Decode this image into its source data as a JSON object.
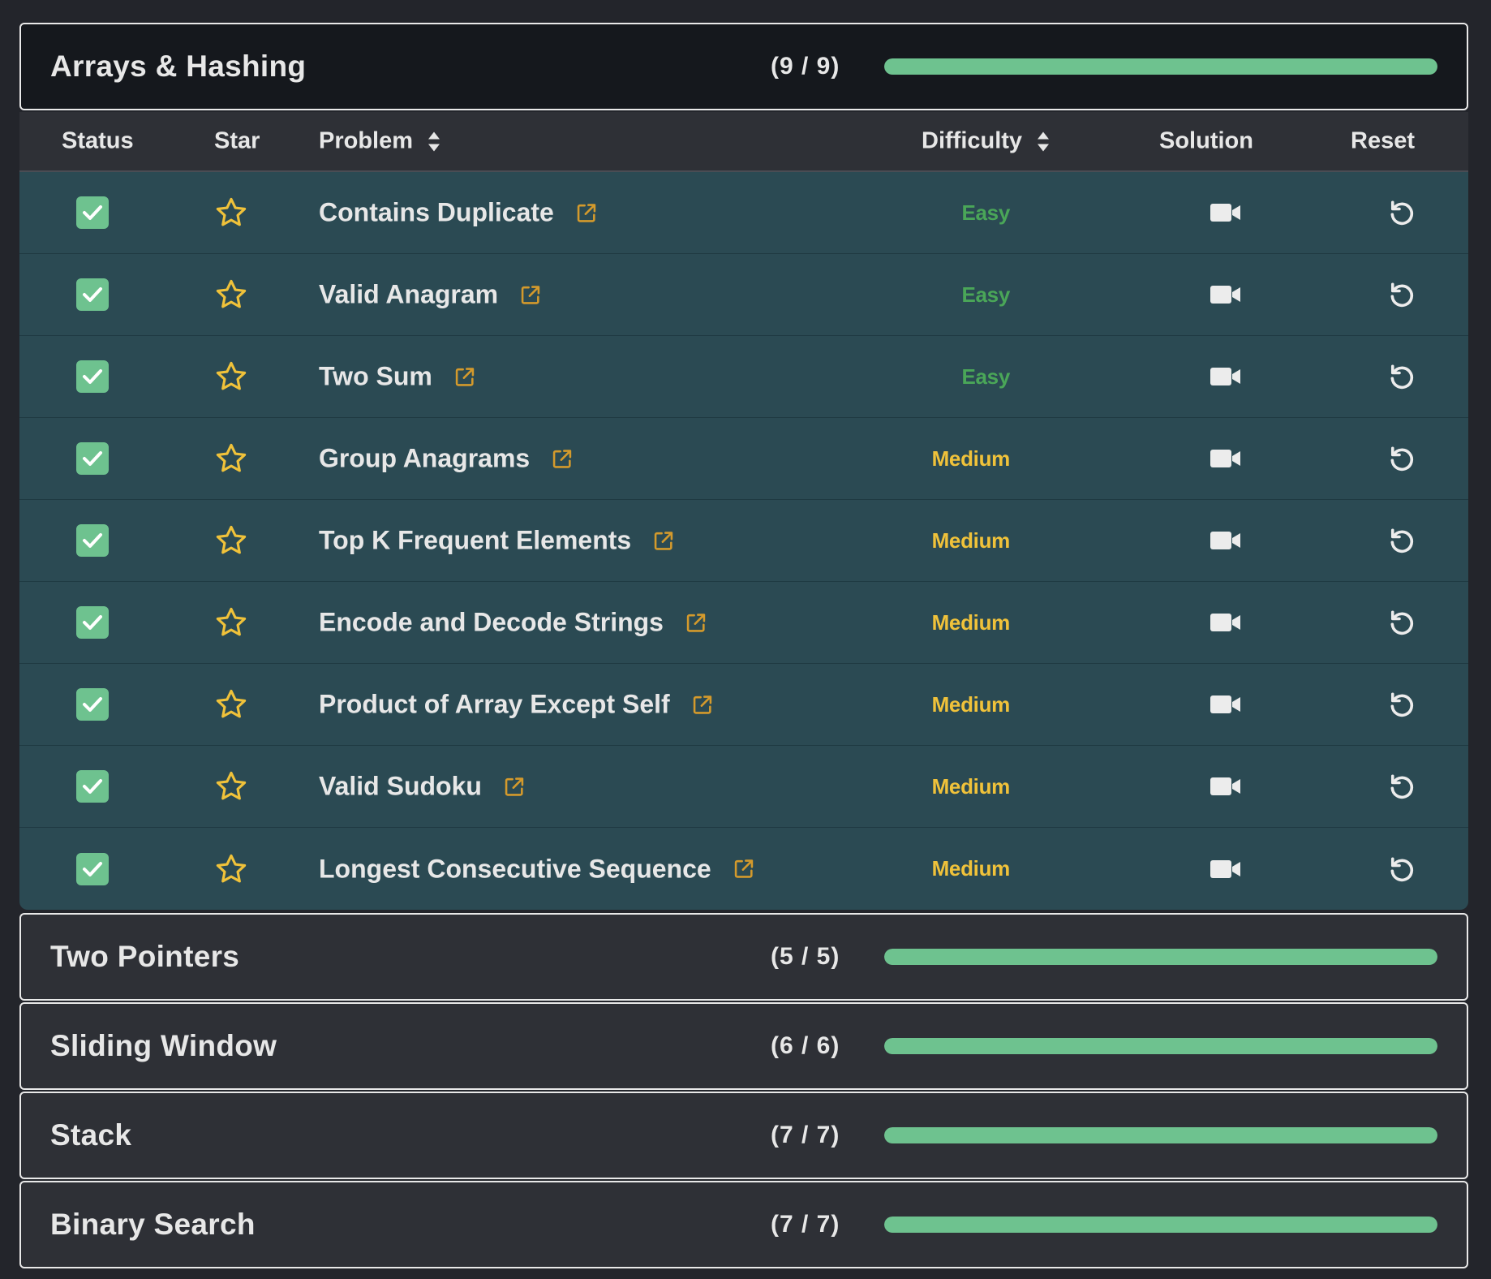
{
  "colors": {
    "progress": "#6ec28f",
    "easy": "#4aa658",
    "medium": "#f0c23a",
    "star": "#f0c23a",
    "check": "#6ec28f",
    "row_bg": "#2b4a53"
  },
  "open_section": {
    "title": "Arrays & Hashing",
    "count": "(9 / 9)",
    "progress": 1.0
  },
  "table": {
    "headers": {
      "status": "Status",
      "star": "Star",
      "problem": "Problem",
      "difficulty": "Difficulty",
      "solution": "Solution",
      "reset": "Reset"
    },
    "rows": [
      {
        "problem": "Contains Duplicate",
        "difficulty": "Easy",
        "status": "checked"
      },
      {
        "problem": "Valid Anagram",
        "difficulty": "Easy",
        "status": "checked"
      },
      {
        "problem": "Two Sum",
        "difficulty": "Easy",
        "status": "checked"
      },
      {
        "problem": "Group Anagrams",
        "difficulty": "Medium",
        "status": "checked"
      },
      {
        "problem": "Top K Frequent Elements",
        "difficulty": "Medium",
        "status": "checked"
      },
      {
        "problem": "Encode and Decode Strings",
        "difficulty": "Medium",
        "status": "checked"
      },
      {
        "problem": "Product of Array Except Self",
        "difficulty": "Medium",
        "status": "checked"
      },
      {
        "problem": "Valid Sudoku",
        "difficulty": "Medium",
        "status": "checked"
      },
      {
        "problem": "Longest Consecutive Sequence",
        "difficulty": "Medium",
        "status": "checked"
      }
    ],
    "icons": {
      "status": "checkbox-checked-icon",
      "star": "star-outline-icon",
      "external": "external-link-icon",
      "solution": "video-camera-icon",
      "reset": "reset-icon",
      "sort": "sort-icon"
    }
  },
  "collapsed_sections": [
    {
      "title": "Two Pointers",
      "count": "(5 / 5)",
      "progress": 1.0
    },
    {
      "title": "Sliding Window",
      "count": "(6 / 6)",
      "progress": 1.0
    },
    {
      "title": "Stack",
      "count": "(7 / 7)",
      "progress": 1.0
    },
    {
      "title": "Binary Search",
      "count": "(7 / 7)",
      "progress": 1.0
    }
  ]
}
